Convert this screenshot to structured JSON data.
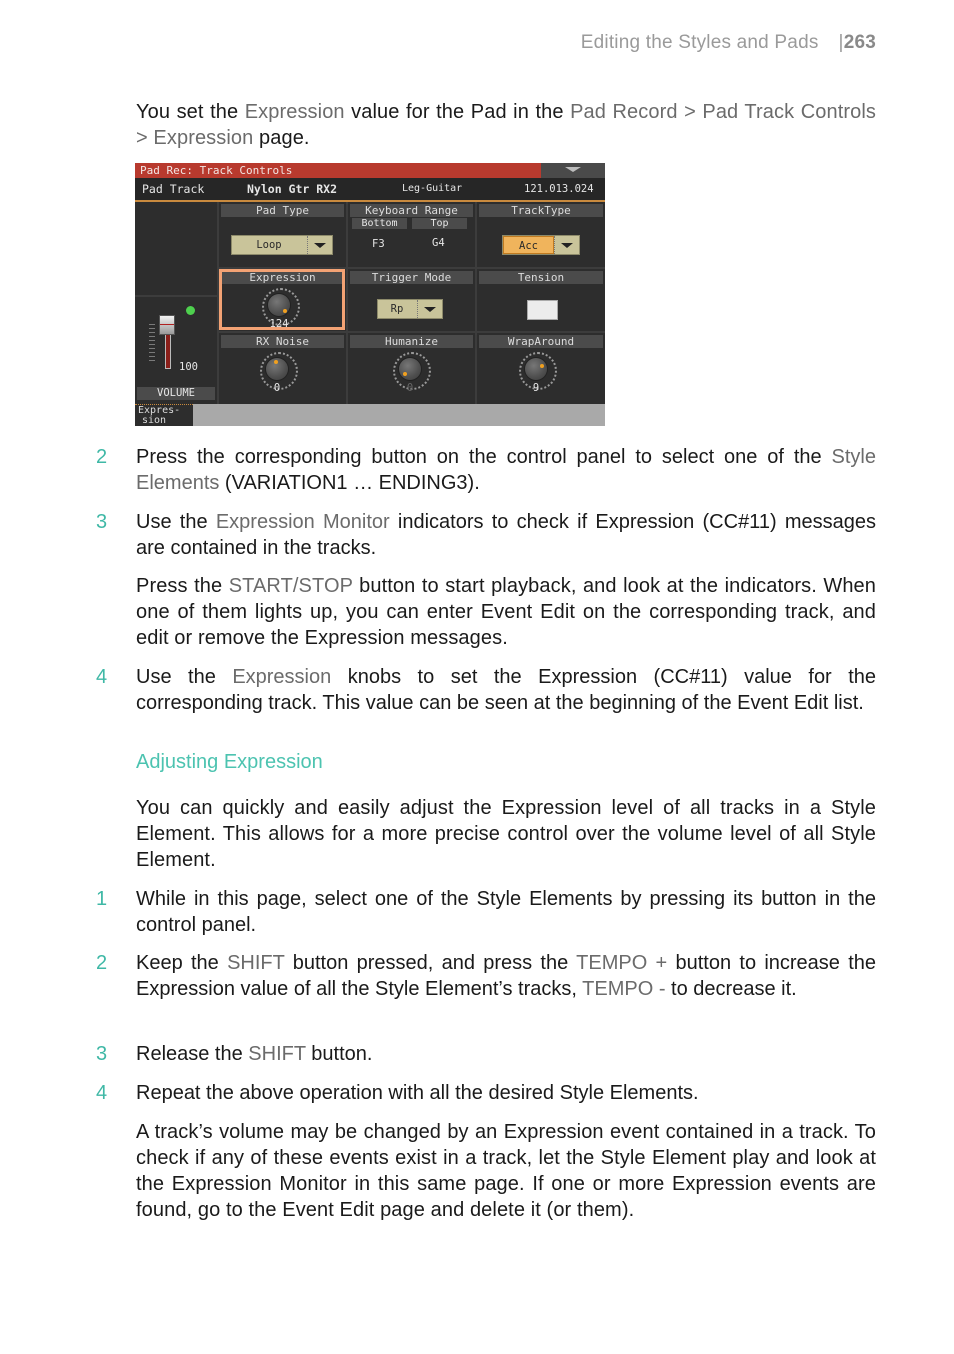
{
  "running_head": {
    "title": "Editing the Styles and Pads",
    "separator": "|",
    "page_number": "263"
  },
  "intro": {
    "t1": "You set the ",
    "k1": "Expression",
    "t2": " value for the Pad in the ",
    "k2": "Pad Record > Pad Track Controls > Expression",
    "t3": " page."
  },
  "screen": {
    "title": "Pad Rec: Track Controls",
    "track_label": "Pad Track",
    "track_name": "Nylon Gtr RX2",
    "track_category": "Leg-Guitar",
    "track_id": "121.013.024",
    "pad_type": {
      "header": "Pad Type",
      "value": "Loop"
    },
    "keyboard_range": {
      "header": "Keyboard Range",
      "bottom_label": "Bottom",
      "top_label": "Top",
      "bottom": "F3",
      "top": "G4"
    },
    "track_type": {
      "header": "TrackType",
      "value": "Acc"
    },
    "expression": {
      "header": "Expression",
      "value": "124"
    },
    "trigger_mode": {
      "header": "Trigger Mode",
      "value": "Rp"
    },
    "tension": {
      "header": "Tension"
    },
    "rx_noise": {
      "header": "RX Noise",
      "value": "0"
    },
    "humanize": {
      "header": "Humanize",
      "value": "0"
    },
    "wraparound": {
      "header": "WrapAround",
      "value": "9"
    },
    "volume": {
      "label": "VOLUME",
      "value": "100"
    },
    "bottom_tab": {
      "line1": "Expres-",
      "line2": "sion"
    },
    "colors": {
      "title_bar": "#b83a2e",
      "selection": "#f3a274",
      "knob_dot": "#f0a020",
      "led": "#4ed04e"
    }
  },
  "steps_a": [
    {
      "num": "2",
      "t1": "Press the corresponding button on the control panel to select one of the ",
      "k1": "Style Elements",
      "t2": " (VARIATION1 … ENDING3)."
    },
    {
      "num": "3",
      "t1": "Use the ",
      "k1": "Expression Monitor",
      "t2": " indicators to check if Expression (CC#11) messages are contained in the tracks."
    }
  ],
  "startstop_para": {
    "t1": "Press the ",
    "k1": "START/STOP",
    "t2": " button to start playback, and look at the indicators. When one of them lights up, you can enter Event Edit on the corresponding track, and edit or remove the Expression messages."
  },
  "step4": {
    "num": "4",
    "t1": "Use the ",
    "k1": "Expression",
    "t2": " knobs to set the Expression (CC#11) value for the corresponding track. This value can be seen at the beginning of the Event Edit list."
  },
  "section": {
    "heading": "Adjusting Expression",
    "intro": "You can quickly and easily adjust the Expression level of all tracks in a Style Element. This allows for a more precise control over the volume level of all Style Element.",
    "steps": [
      {
        "num": "1",
        "text": "While in this page, select one of the Style Elements by pressing its button in the control panel."
      },
      {
        "num": "2",
        "t1": "Keep the ",
        "k1": "SHIFT",
        "t2": " button pressed, and press the ",
        "k2": "TEMPO +",
        "t3": " button to increase the Expression value of all the Style Element’s tracks, ",
        "k3": "TEMPO -",
        "t4": " to decrease it."
      },
      {
        "num": "3",
        "t1": "Release the ",
        "k1": "SHIFT",
        "t2": " button."
      },
      {
        "num": "4",
        "text": "Repeat the above operation with all the desired Style Elements."
      }
    ],
    "note": "A track’s volume may be changed by an Expression event contained in a track. To check if any of these events exist in a track, let the Style Element play and look at the Expression Monitor in this same page. If one or more Expression events are found, go to the Event Edit page and delete it (or them)."
  }
}
